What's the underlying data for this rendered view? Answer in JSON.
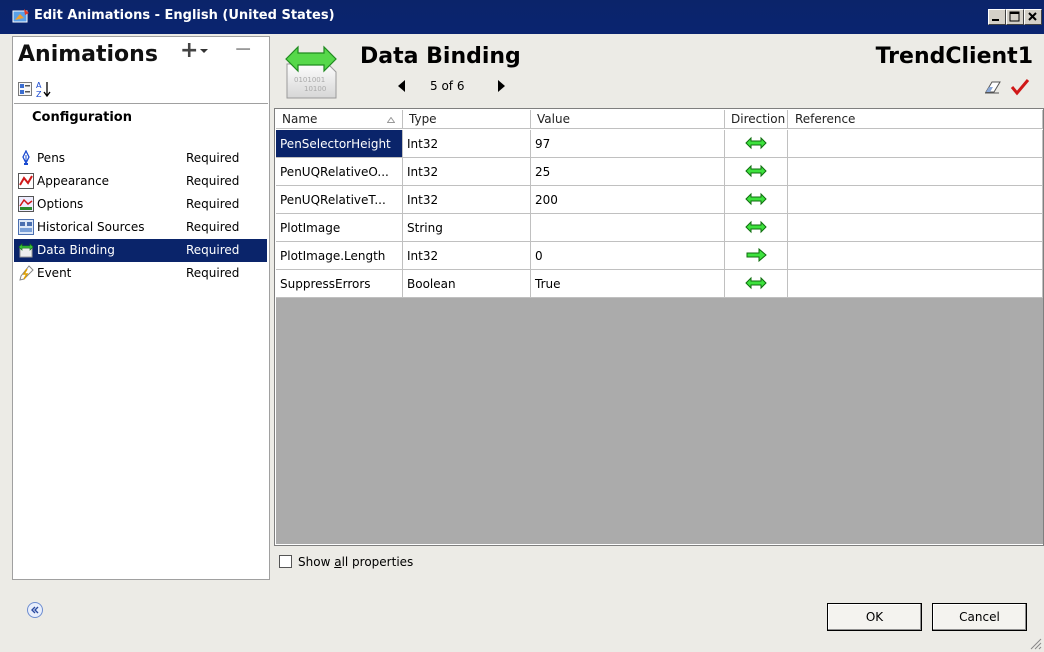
{
  "window": {
    "title": "Edit Animations - English (United States)",
    "colors": {
      "titlebar": "#0a246a",
      "selection": "#0a246a",
      "grid_empty": "#ababab",
      "dialog_bg": "#ecebe6"
    }
  },
  "left": {
    "header": "Animations",
    "add_label": "+",
    "remove_label": "−",
    "section": "Configuration",
    "items": [
      {
        "icon": "pen-icon",
        "label": "Pens",
        "status": "Required"
      },
      {
        "icon": "appearance-icon",
        "label": "Appearance",
        "status": "Required"
      },
      {
        "icon": "options-icon",
        "label": "Options",
        "status": "Required"
      },
      {
        "icon": "historical-sources-icon",
        "label": "Historical Sources",
        "status": "Required"
      },
      {
        "icon": "data-binding-icon",
        "label": "Data Binding",
        "status": "Required",
        "selected": true
      },
      {
        "icon": "event-icon",
        "label": "Event",
        "status": "Required"
      }
    ]
  },
  "right": {
    "title": "Data Binding",
    "page": "5 of 6",
    "object_name": "TrendClient1",
    "icon_text": [
      "0101001",
      "10100"
    ]
  },
  "grid": {
    "columns": [
      "Name",
      "Type",
      "Value",
      "Direction",
      "Reference"
    ],
    "rows": [
      {
        "name": "PenSelectorHeight",
        "type": "Int32",
        "value": "97",
        "direction": "both",
        "reference": "",
        "selected": true
      },
      {
        "name": "PenUQRelativeO...",
        "type": "Int32",
        "value": "25",
        "direction": "both",
        "reference": ""
      },
      {
        "name": "PenUQRelativeT...",
        "type": "Int32",
        "value": "200",
        "direction": "both",
        "reference": ""
      },
      {
        "name": "PlotImage",
        "type": "String",
        "value": "",
        "direction": "both",
        "reference": ""
      },
      {
        "name": "PlotImage.Length",
        "type": "Int32",
        "value": "0",
        "direction": "right",
        "reference": ""
      },
      {
        "name": "SuppressErrors",
        "type": "Boolean",
        "value": "True",
        "direction": "both",
        "reference": ""
      }
    ]
  },
  "footer": {
    "show_all": {
      "pre": "Show ",
      "underlined": "a",
      "post": "ll properties",
      "checked": false
    },
    "ok_label": "OK",
    "cancel_label": "Cancel"
  }
}
